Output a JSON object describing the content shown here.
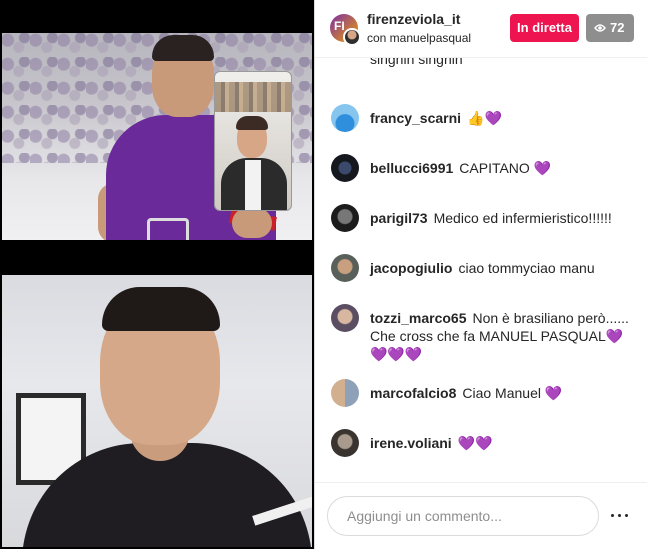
{
  "header": {
    "host_username": "firenzeviola_it",
    "subtitle": "con manuelpasqual",
    "live_label": "In diretta",
    "viewer_count": "72",
    "host_avatar_text": "FI"
  },
  "comments": {
    "overflow_text": "singhin singhin",
    "items": [
      {
        "username": "francy_scarni",
        "text": "👍💜"
      },
      {
        "username": "bellucci6991",
        "text": "CAPITANO 💜"
      },
      {
        "username": "parigil73",
        "text": "Medico ed infermieristico!!!!!!"
      },
      {
        "username": "jacopogiulio",
        "text": "ciao tommyciao manu"
      },
      {
        "username": "tozzi_marco65",
        "text": "Non è brasiliano però...... Che cross che fa MANUEL PASQUAL💜💜💜💜"
      },
      {
        "username": "marcofalcio8",
        "text": "Ciao Manuel 💜"
      },
      {
        "username": "irene.voliani",
        "text": "💜💜"
      }
    ]
  },
  "footer": {
    "input_placeholder": "Aggiungi un commento..."
  },
  "colors": {
    "live_badge": "#ed1450",
    "viewer_badge": "#8e8e8e",
    "fiorentina_purple": "#6b2a9a"
  }
}
